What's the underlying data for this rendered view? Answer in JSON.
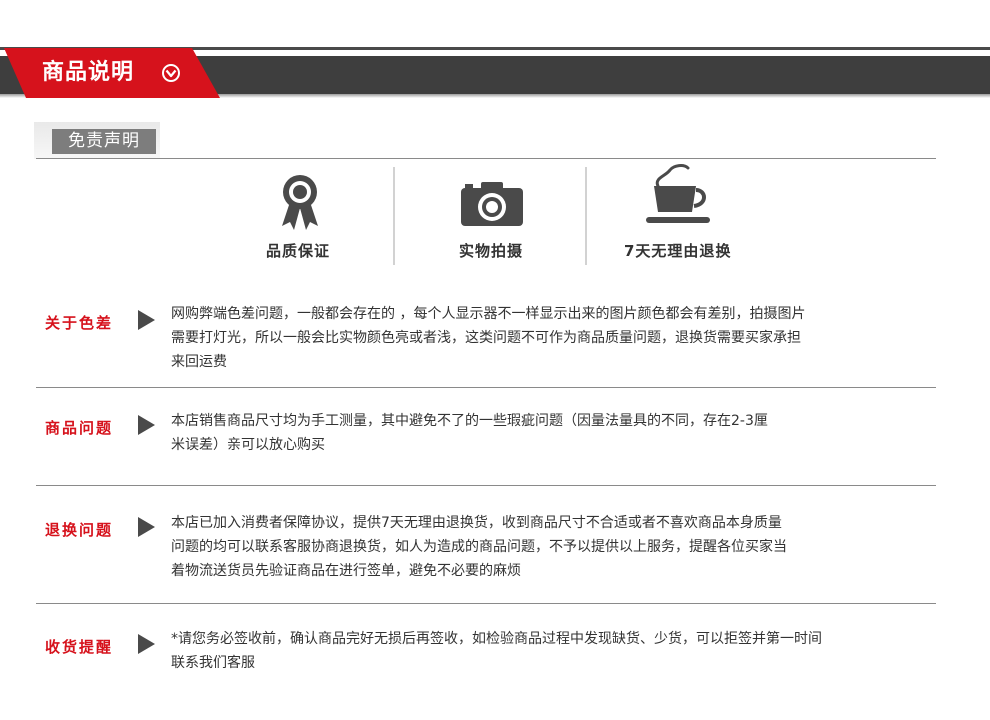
{
  "header": {
    "title": "商品说明",
    "accent_color": "#d6121c",
    "bar_color": "#3e3e3e"
  },
  "disclaimer": {
    "label": "免责声明"
  },
  "features": [
    {
      "icon": "award-ribbon-icon",
      "label": "品质保证"
    },
    {
      "icon": "camera-icon",
      "label": "实物拍摄"
    },
    {
      "icon": "coffee-cup-icon",
      "label": "7天无理由退换"
    }
  ],
  "notices": [
    {
      "title": "关于色差",
      "lines": [
        "网购弊端色差问题，一般都会存在的 ，每个人显示器不一样显示出来的图片颜色都会有差别，拍摄图片",
        "需要打灯光，所以一般会比实物颜色亮或者浅，这类问题不可作为商品质量问题，退换货需要买家承担",
        "来回运费"
      ]
    },
    {
      "title": "商品问题",
      "lines": [
        "本店销售商品尺寸均为手工测量，其中避免不了的一些瑕疵问题（因量法量具的不同，存在2-3厘",
        "米误差）亲可以放心购买"
      ]
    },
    {
      "title": "退换问题",
      "lines": [
        "本店已加入消费者保障协议，提供7天无理由退换货，收到商品尺寸不合适或者不喜欢商品本身质量",
        "问题的均可以联系客服协商退换货，如人为造成的商品问题，不予以提供以上服务，提醒各位买家当",
        "着物流送货员先验证商品在进行签单，避免不必要的麻烦"
      ]
    },
    {
      "title": "收货提醒",
      "lines": [
        "*请您务必签收前，确认商品完好无损后再签收，如检验商品过程中发现缺货、少货，可以拒签并第一时间",
        "联系我们客服"
      ]
    }
  ]
}
